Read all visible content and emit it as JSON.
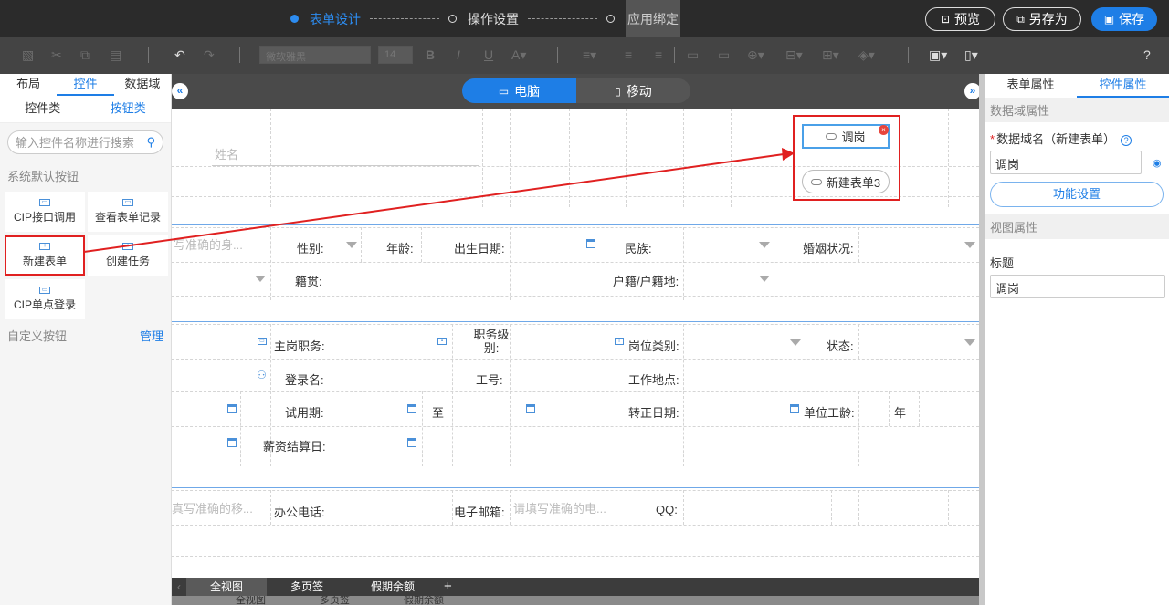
{
  "steps": [
    {
      "label": "表单设计"
    },
    {
      "label": "操作设置"
    },
    {
      "label": "应用绑定"
    }
  ],
  "top_buttons": {
    "preview": "预览",
    "save_as": "另存为",
    "save": "保存"
  },
  "toolbar": {
    "font_name": "微软雅黑",
    "font_size": "14"
  },
  "left": {
    "tabs": [
      "布局",
      "控件",
      "数据域"
    ],
    "subtabs": [
      "控件类",
      "按钮类"
    ],
    "search_placeholder": "输入控件名称进行搜索",
    "system_title": "系统默认按钮",
    "buttons": [
      "CIP接口调用",
      "查看表单记录",
      "新建表单",
      "创建任务",
      "CIP单点登录"
    ],
    "custom_title": "自定义按钮",
    "manage": "管理"
  },
  "canvas": {
    "devices": [
      "电脑",
      "移动"
    ],
    "name_placeholder": "姓名",
    "buttons": {
      "transfer": "调岗",
      "new_form": "新建表单3"
    },
    "row1": {
      "id_placeholder": "写准确的身...",
      "gender": "性别:",
      "age": "年龄:",
      "birth": "出生日期:",
      "ethnic": "民族:",
      "marital": "婚姻状况:"
    },
    "row2": {
      "native": "籍贯:",
      "hukou": "户籍/户籍地:"
    },
    "row3": {
      "main_post": "主岗职务:",
      "level": "职务级别:",
      "post_type": "岗位类别:",
      "status": "状态:"
    },
    "row4": {
      "login": "登录名:",
      "job_no": "工号:",
      "work_place": "工作地点:"
    },
    "row5": {
      "probation": "试用期:",
      "to": "至",
      "regular_date": "转正日期:",
      "seniority": "单位工龄:",
      "year": "年"
    },
    "row6": {
      "salary_day": "薪资结算日:"
    },
    "row7": {
      "mobile_placeholder": "真写准确的移...",
      "office_phone": "办公电话:",
      "email": "电子邮箱:",
      "email_placeholder": "请填写准确的电...",
      "qq": "QQ:"
    }
  },
  "bottom_tabs": [
    "全视图",
    "多页签",
    "假期余额"
  ],
  "right": {
    "tabs": [
      "表单属性",
      "控件属性"
    ],
    "data_section": "数据域属性",
    "field_label": "数据域名（新建表单）",
    "field_value": "调岗",
    "func_button": "功能设置",
    "view_section": "视图属性",
    "title_label": "标题",
    "title_value": "调岗"
  },
  "colors": {
    "accent": "#1e7ee6",
    "highlight": "#e02020"
  }
}
